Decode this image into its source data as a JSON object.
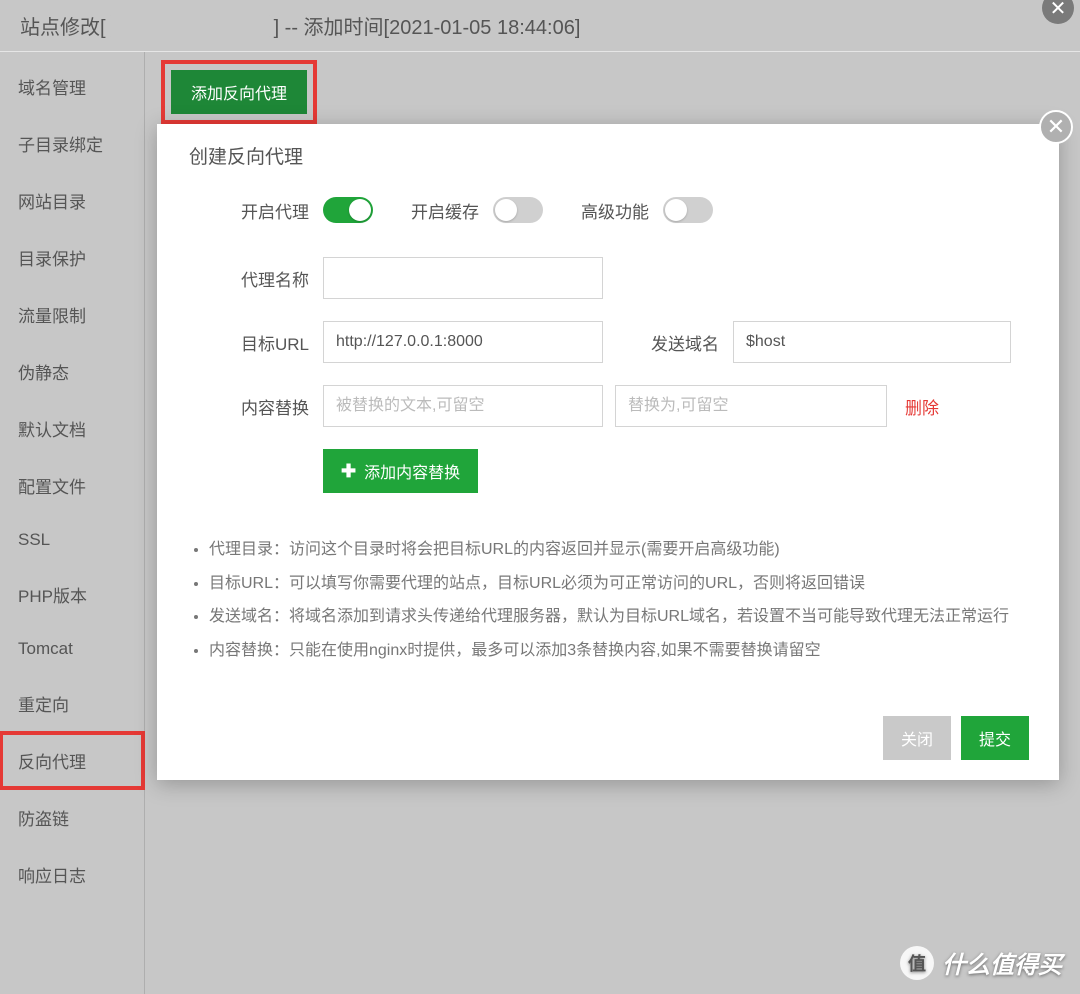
{
  "title": {
    "prefix": "站点修改[",
    "suffix": "] -- 添加时间[2021-01-05 18:44:06]"
  },
  "sidebar": {
    "items": [
      {
        "label": "域名管理"
      },
      {
        "label": "子目录绑定"
      },
      {
        "label": "网站目录"
      },
      {
        "label": "目录保护"
      },
      {
        "label": "流量限制"
      },
      {
        "label": "伪静态"
      },
      {
        "label": "默认文档"
      },
      {
        "label": "配置文件"
      },
      {
        "label": "SSL"
      },
      {
        "label": "PHP版本"
      },
      {
        "label": "Tomcat"
      },
      {
        "label": "重定向"
      },
      {
        "label": "反向代理"
      },
      {
        "label": "防盗链"
      },
      {
        "label": "响应日志"
      }
    ],
    "highlighted_index": 12
  },
  "top_button": "添加反向代理",
  "modal": {
    "title": "创建反向代理",
    "toggles": {
      "enable_proxy": {
        "label": "开启代理",
        "on": true
      },
      "enable_cache": {
        "label": "开启缓存",
        "on": false
      },
      "advanced": {
        "label": "高级功能",
        "on": false
      }
    },
    "proxy_name": {
      "label": "代理名称",
      "value": ""
    },
    "target_url": {
      "label": "目标URL",
      "value": "http://127.0.0.1:8000"
    },
    "send_domain": {
      "label": "发送域名",
      "value": "$host"
    },
    "content_replace": {
      "label": "内容替换",
      "from_placeholder": "被替换的文本,可留空",
      "to_placeholder": "替换为,可留空",
      "delete": "删除",
      "add_button": "添加内容替换"
    },
    "help": [
      "代理目录：访问这个目录时将会把目标URL的内容返回并显示(需要开启高级功能)",
      "目标URL：可以填写你需要代理的站点，目标URL必须为可正常访问的URL，否则将返回错误",
      "发送域名：将域名添加到请求头传递给代理服务器，默认为目标URL域名，若设置不当可能导致代理无法正常运行",
      "内容替换：只能在使用nginx时提供，最多可以添加3条替换内容,如果不需要替换请留空"
    ],
    "footer": {
      "close": "关闭",
      "submit": "提交"
    }
  },
  "watermark": {
    "badge": "值",
    "text": "什么值得买"
  }
}
